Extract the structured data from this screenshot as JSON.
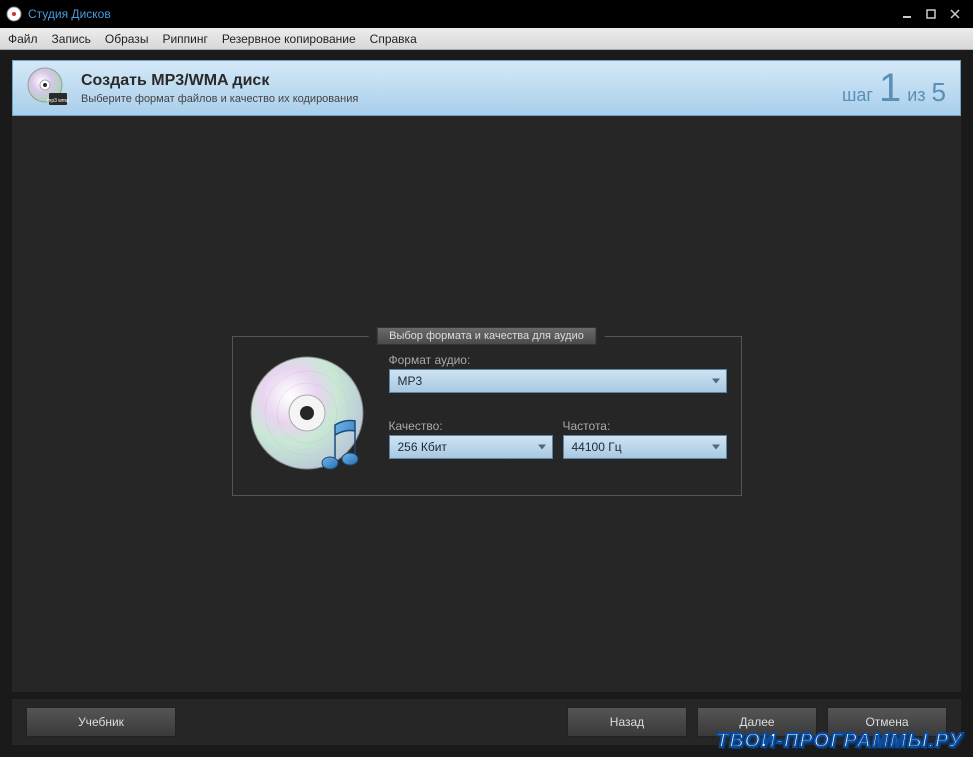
{
  "app": {
    "title": "Студия Дисков"
  },
  "menu": {
    "file": "Файл",
    "record": "Запись",
    "images": "Образы",
    "ripping": "Риппинг",
    "backup": "Резервное копирование",
    "help": "Справка"
  },
  "banner": {
    "title": "Создать MP3/WMA диск",
    "subtitle": "Выберите формат файлов и качество их кодирования",
    "step_word": "шаг",
    "step_num": "1",
    "of_word": "из",
    "total": "5"
  },
  "group": {
    "title": "Выбор формата и качества для аудио",
    "format_label": "Формат аудио:",
    "format_value": "MP3",
    "quality_label": "Качество:",
    "quality_value": "256 Кбит",
    "freq_label": "Частота:",
    "freq_value": "44100 Гц"
  },
  "buttons": {
    "tutorial": "Учебник",
    "back": "Назад",
    "next": "Далее",
    "cancel": "Отмена"
  },
  "watermark": "ТВОИ-ПРОГРАММЫ.РУ"
}
